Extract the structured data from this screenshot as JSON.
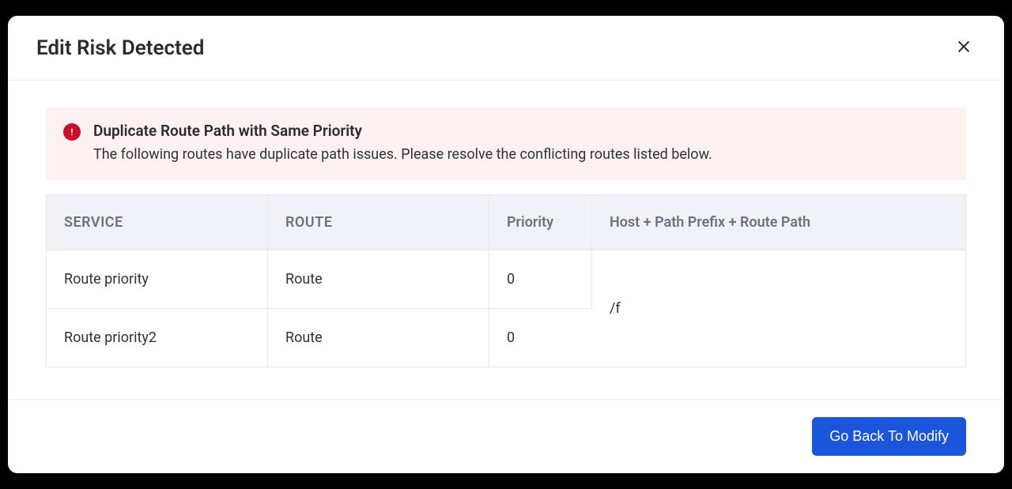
{
  "dialog": {
    "title": "Edit Risk Detected"
  },
  "alert": {
    "title": "Duplicate Route Path with Same Priority",
    "message": "The following routes have duplicate path issues. Please resolve the conflicting routes listed below."
  },
  "table": {
    "headers": {
      "service": "SERVICE",
      "route": "ROUTE",
      "priority": "Priority",
      "hostpath": "Host + Path Prefix + Route Path"
    },
    "rows": [
      {
        "service": "Route priority",
        "route": "Route",
        "priority": "0"
      },
      {
        "service": "Route priority2",
        "route": "Route",
        "priority": "0"
      }
    ],
    "merged_hostpath": "/f"
  },
  "footer": {
    "back_label": "Go Back To Modify"
  }
}
